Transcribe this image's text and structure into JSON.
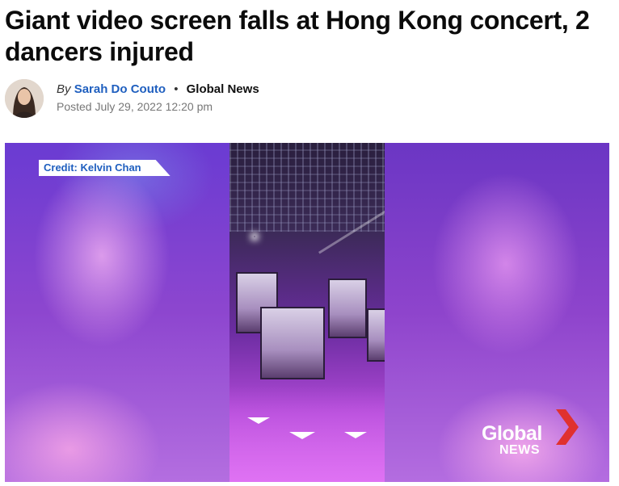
{
  "article": {
    "headline": "Giant video screen falls at Hong Kong concert, 2 dancers injured",
    "byline": {
      "by": "By",
      "author": "Sarah Do Couto",
      "separator": "•",
      "outlet": "Global News",
      "posted": "Posted July 29, 2022 12:20 pm"
    }
  },
  "media": {
    "credit": "Credit: Kelvin Chan",
    "logo": {
      "word": "Global",
      "sub": "NEWS"
    }
  },
  "colors": {
    "author_link": "#1f5fbf",
    "brand_red": "#e0312f",
    "stage_purple": "#8a3fc4"
  }
}
